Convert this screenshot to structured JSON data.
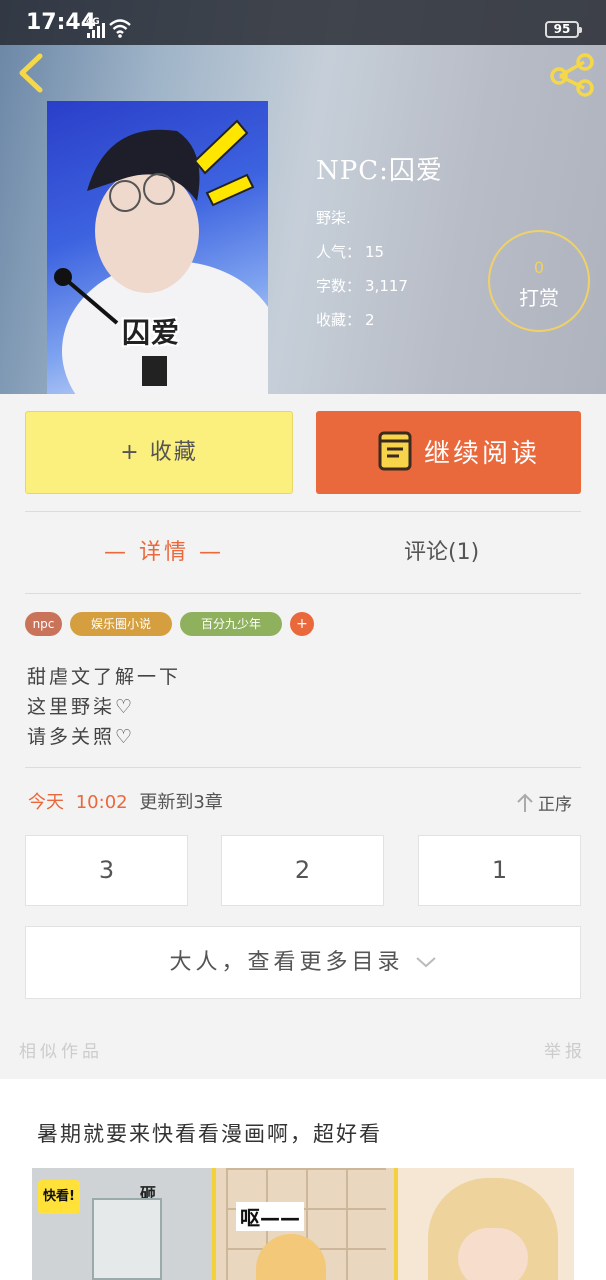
{
  "status_bar": {
    "time": "17:44",
    "network": "4G",
    "battery": "95"
  },
  "book": {
    "cover_text": "囚爱",
    "title": "NPC:囚爱",
    "author": "野柒.",
    "popularity_label": "人气：",
    "popularity": "15",
    "word_count_label": "字数：",
    "word_count": "3,117",
    "favorites_label": "收藏：",
    "favorites": "2"
  },
  "reward": {
    "count": "0",
    "label": "打赏"
  },
  "actions": {
    "collect_label": "+ 收藏",
    "read_label": "继续阅读"
  },
  "tabs": {
    "detail": "— 详情 —",
    "comments": "评论(1)"
  },
  "tags": [
    {
      "label": "npc",
      "color": "#c9735a"
    },
    {
      "label": "娱乐圈小说",
      "color": "#d59f3f"
    },
    {
      "label": "百分九少年",
      "color": "#8fb15d"
    },
    {
      "label": "+",
      "color": "#e9683c"
    }
  ],
  "description": [
    "甜虐文了解一下",
    "这里野柒♡",
    "请多关照♡"
  ],
  "update": {
    "today": "今天",
    "time": "10:02",
    "text": "更新到3章"
  },
  "sort_label": "正序",
  "chapters": [
    "3",
    "2",
    "1"
  ],
  "more_toc_label": "大人，查看更多目录",
  "similar_label": "相似作品",
  "report_label": "举报",
  "promo": {
    "title": "暑期就要来快看看漫画啊，超好看",
    "logo": "快看!",
    "sfx1": "砸",
    "sfx2": "呕——"
  },
  "colors": {
    "accent": "#e9683c",
    "collect_bg": "#fbef7d",
    "reward_ring": "#f0d169"
  }
}
